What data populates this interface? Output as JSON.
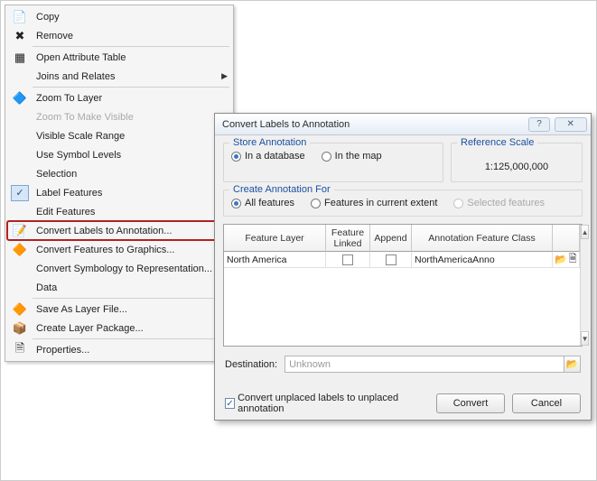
{
  "menu": {
    "items": [
      {
        "label": "Copy",
        "icon": "📄"
      },
      {
        "label": "Remove",
        "icon": "✖"
      },
      "sep",
      {
        "label": "Open Attribute Table",
        "icon": "▦"
      },
      {
        "label": "Joins and Relates",
        "icon": "",
        "submenu": true
      },
      "sep",
      {
        "label": "Zoom To Layer",
        "icon": "🔷"
      },
      {
        "label": "Zoom To Make Visible",
        "icon": "",
        "disabled": true
      },
      {
        "label": "Visible Scale Range",
        "icon": "",
        "submenu": true
      },
      {
        "label": "Use Symbol Levels",
        "icon": ""
      },
      {
        "label": "Selection",
        "icon": "",
        "submenu": true
      },
      {
        "label": "Label Features",
        "icon": "",
        "checked": true
      },
      {
        "label": "Edit Features",
        "icon": "",
        "submenu": true
      },
      {
        "label": "Convert Labels to Annotation...",
        "icon": "📝",
        "highlight": true
      },
      {
        "label": "Convert Features to Graphics...",
        "icon": "🔶"
      },
      {
        "label": "Convert Symbology to Representation...",
        "icon": ""
      },
      {
        "label": "Data",
        "icon": "",
        "submenu": true
      },
      "sep",
      {
        "label": "Save As Layer File...",
        "icon": "🔶"
      },
      {
        "label": "Create Layer Package...",
        "icon": "📦"
      },
      "sep",
      {
        "label": "Properties...",
        "icon": "🗎"
      }
    ]
  },
  "dialog": {
    "title": "Convert Labels to Annotation",
    "store_annotation": {
      "legend": "Store Annotation",
      "opt_db": "In a database",
      "opt_map": "In the map"
    },
    "reference_scale": {
      "legend": "Reference Scale",
      "value": "1:125,000,000"
    },
    "create_for": {
      "legend": "Create Annotation For",
      "opt_all": "All features",
      "opt_extent": "Features in current extent",
      "opt_selected": "Selected features"
    },
    "table": {
      "headers": {
        "feature_layer": "Feature Layer",
        "feature_linked": "Feature Linked",
        "append": "Append",
        "anno_class": "Annotation Feature Class"
      },
      "rows": [
        {
          "feature_layer": "North America",
          "anno_class": "NorthAmericaAnno"
        }
      ]
    },
    "destination_label": "Destination:",
    "destination_value": "Unknown",
    "convert_unplaced": "Convert unplaced labels to unplaced annotation",
    "btn_convert": "Convert",
    "btn_cancel": "Cancel"
  }
}
